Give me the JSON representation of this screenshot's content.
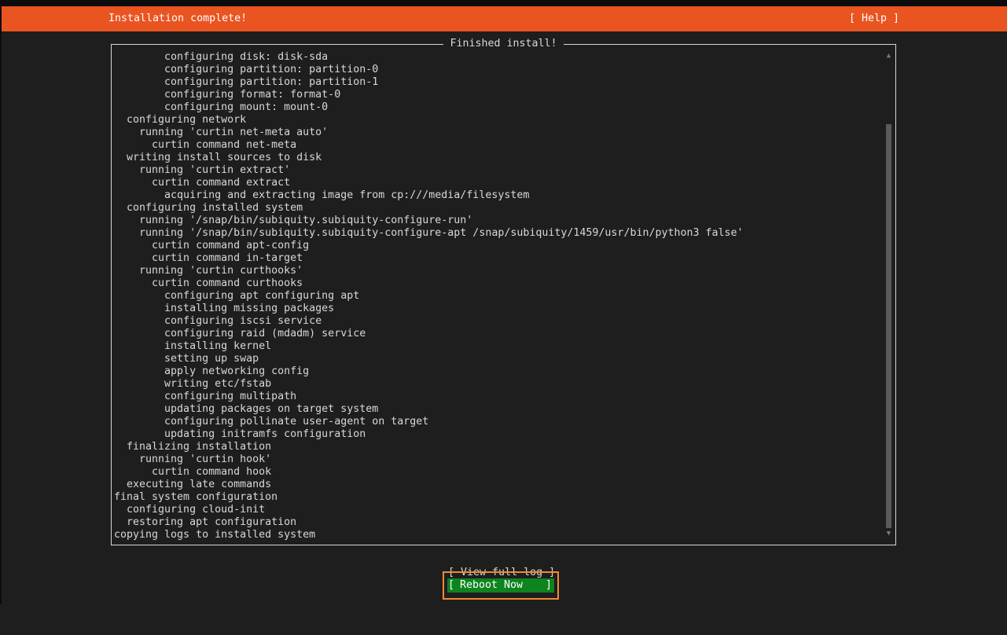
{
  "header": {
    "title": "Installation complete!",
    "help": "[ Help ]"
  },
  "log": {
    "title": "Finished install!",
    "lines": [
      "        configuring disk: disk-sda",
      "        configuring partition: partition-0",
      "        configuring partition: partition-1",
      "        configuring format: format-0",
      "        configuring mount: mount-0",
      "  configuring network",
      "    running 'curtin net-meta auto'",
      "      curtin command net-meta",
      "  writing install sources to disk",
      "    running 'curtin extract'",
      "      curtin command extract",
      "        acquiring and extracting image from cp:///media/filesystem",
      "  configuring installed system",
      "    running '/snap/bin/subiquity.subiquity-configure-run'",
      "    running '/snap/bin/subiquity.subiquity-configure-apt /snap/subiquity/1459/usr/bin/python3 false'",
      "      curtin command apt-config",
      "      curtin command in-target",
      "    running 'curtin curthooks'",
      "      curtin command curthooks",
      "        configuring apt configuring apt",
      "        installing missing packages",
      "        configuring iscsi service",
      "        configuring raid (mdadm) service",
      "        installing kernel",
      "        setting up swap",
      "        apply networking config",
      "        writing etc/fstab",
      "        configuring multipath",
      "        updating packages on target system",
      "        configuring pollinate user-agent on target",
      "        updating initramfs configuration",
      "  finalizing installation",
      "    running 'curtin hook'",
      "      curtin command hook",
      "  executing late commands",
      "final system configuration",
      "  configuring cloud-init",
      "  restoring apt configuration",
      "copying logs to installed system"
    ]
  },
  "buttons": {
    "view_full_log": "[ View full log ]",
    "reboot_left": "[",
    "reboot_label": "Reboot Now",
    "reboot_right": "]"
  },
  "colors": {
    "header_bg": "#e95420",
    "reboot_bg": "#0e8420",
    "focus_outline": "#f28b30",
    "background": "#1e1e1e"
  }
}
